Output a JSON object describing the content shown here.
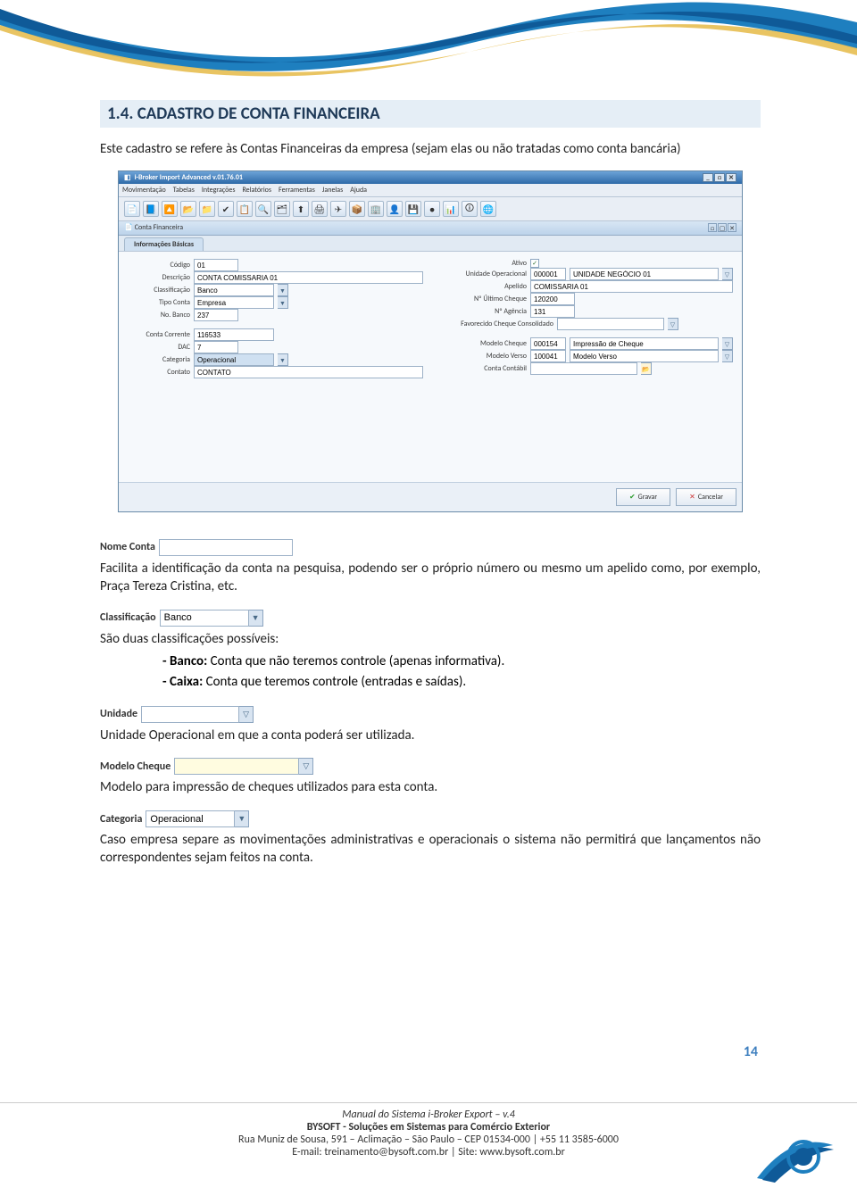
{
  "heading": "1.4.   CADASTRO DE CONTA FINANCEIRA",
  "intro": "Este cadastro se refere às Contas Financeiras da empresa (sejam elas ou não tratadas como conta bancária)",
  "app": {
    "title": "i-Broker Import Advanced v.01.76.01",
    "menus": [
      "Movimentação",
      "Tabelas",
      "Integrações",
      "Relatórios",
      "Ferramentas",
      "Janelas",
      "Ajuda"
    ],
    "subwindow_title": "Conta Financeira",
    "tab": "Informações Básicas",
    "left_fields": {
      "codigo_label": "Código",
      "codigo_value": "01",
      "descricao_label": "Descrição",
      "descricao_value": "CONTA COMISSARIA 01",
      "classificacao_label": "Classificação",
      "classificacao_value": "Banco",
      "tipo_conta_label": "Tipo Conta",
      "tipo_conta_value": "Empresa",
      "no_banco_label": "No. Banco",
      "no_banco_value": "237",
      "conta_corrente_label": "Conta Corrente",
      "conta_corrente_value": "116533",
      "dac_label": "DAC",
      "dac_value": "7",
      "categoria_label": "Categoria",
      "categoria_value": "Operacional",
      "contato_label": "Contato",
      "contato_value": "CONTATO"
    },
    "right_fields": {
      "ativo_label": "Ativo",
      "unidade_label": "Unidade Operacional",
      "unidade_code": "000001",
      "unidade_desc": "UNIDADE NEGÓCIO 01",
      "apelido_label": "Apelido",
      "apelido_value": "COMISSARIA 01",
      "ultimo_cheque_label": "Nº Último Cheque",
      "ultimo_cheque_value": "120200",
      "agencia_label": "Nº Agência",
      "agencia_value": "131",
      "favorecido_label": "Favorecido Cheque Consolidado",
      "modelo_cheque_label": "Modelo Cheque",
      "modelo_cheque_code": "000154",
      "modelo_cheque_desc": "Impressão de Cheque",
      "modelo_verso_label": "Modelo Verso",
      "modelo_verso_code": "100041",
      "modelo_verso_desc": "Modelo Verso",
      "conta_contabil_label": "Conta Contábil"
    },
    "gravar": "Gravar",
    "cancelar": "Cancelar"
  },
  "snippets": {
    "nome_conta_label": "Nome Conta",
    "classificacao_label": "Classificação",
    "classificacao_value": "Banco",
    "unidade_label": "Unidade",
    "modelo_cheque_label": "Modelo Cheque",
    "categoria_label": "Categoria",
    "categoria_value": "Operacional"
  },
  "para_nome": "Facilita a identificação da conta na pesquisa, podendo ser o próprio número ou mesmo um apelido como, por exemplo, Praça Tereza Cristina, etc.",
  "class_intro": "São duas classificações possíveis:",
  "class_banco_label": "- Banco:",
  "class_banco_text": " Conta que não teremos controle (apenas informativa).",
  "class_caixa_label": "- Caixa:",
  "class_caixa_text": " Conta que teremos controle (entradas e saídas).",
  "para_unidade": "Unidade Operacional em que a conta poderá ser utilizada.",
  "para_modelo": "Modelo para impressão de cheques utilizados para esta conta.",
  "para_categoria": "Caso empresa separe as movimentações administrativas e operacionais o sistema não permitirá que lançamentos não correspondentes sejam feitos na conta.",
  "page_number": "14",
  "footer": {
    "line1": "Manual do Sistema i-Broker Export – v.4",
    "line2": "BYSOFT - Soluções em Sistemas para Comércio Exterior",
    "line3": "Rua Muniz de Sousa, 591 – Aclimação – São Paulo – CEP 01534-000 | +55 11 3585-6000",
    "line4": "E-mail: treinamento@bysoft.com.br | Site: www.bysoft.com.br"
  }
}
